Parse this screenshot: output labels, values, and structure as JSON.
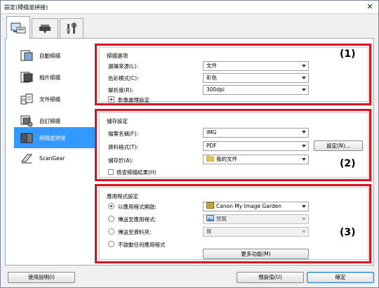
{
  "window": {
    "title": "設定(掃描並拼接)"
  },
  "sidebar": {
    "items": [
      {
        "label": "自動掃描",
        "icon": "auto-scan-icon"
      },
      {
        "label": "相片掃描",
        "icon": "photo-scan-icon"
      },
      {
        "label": "文件掃描",
        "icon": "document-scan-icon"
      },
      {
        "label": "自訂掃描",
        "icon": "custom-scan-icon"
      },
      {
        "label": "掃描並拼接",
        "icon": "stitch-scan-icon",
        "selected": true
      },
      {
        "label": "ScanGear",
        "icon": "scangear-icon"
      }
    ]
  },
  "scan_options": {
    "marker": "(1)",
    "title": "掃描選項",
    "source_label": "選擇來源(L):",
    "source_value": "文件",
    "color_mode_label": "色彩模式(C):",
    "color_mode_value": "彩色",
    "resolution_label": "解析度(R):",
    "resolution_value": "300dpi",
    "image_processing_label": "影像處理設定"
  },
  "save_settings": {
    "marker": "(2)",
    "title": "儲存設定",
    "file_name_label": "檔案名稱(F):",
    "file_name_value": "IMG",
    "data_format_label": "資料格式(T):",
    "data_format_value": "PDF",
    "settings_button": "設定(N)...",
    "save_in_label": "儲存於(A):",
    "save_in_value": "我的文件",
    "check_results_label": "檢查掃描結果(H)"
  },
  "app_settings": {
    "marker": "(3)",
    "title": "應用程式設定",
    "options": [
      {
        "label": "以應用程式開啟:",
        "value": "Canon My Image Garden",
        "checked": true,
        "disabled": false
      },
      {
        "label": "傳送至應用程式:",
        "value": "預覽",
        "checked": false,
        "disabled": true
      },
      {
        "label": "傳送至資料夾:",
        "value": "無",
        "checked": false,
        "disabled": true
      },
      {
        "label": "不啟動任何應用程式",
        "checked": false
      }
    ],
    "more_functions_button": "更多功能(M)"
  },
  "footer": {
    "help_button": "使用說明(I)",
    "defaults_button": "預設值(U)",
    "ok_button": "確定"
  },
  "colors": {
    "highlight_red": "#e0101e",
    "selection_blue": "#3399ff"
  }
}
